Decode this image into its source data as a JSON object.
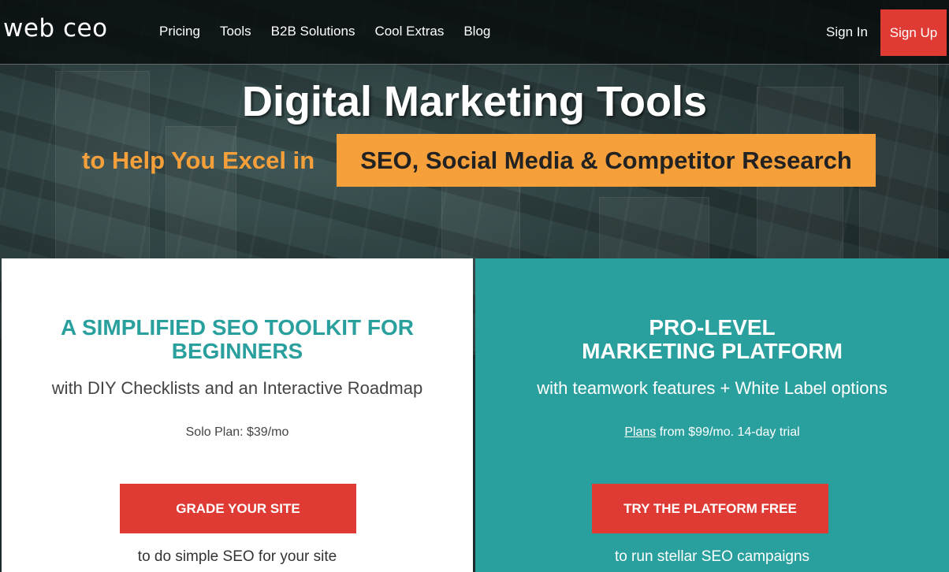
{
  "header": {
    "logo_text": "web ceo",
    "nav": [
      {
        "label": "Pricing"
      },
      {
        "label": "Tools"
      },
      {
        "label": "B2B Solutions"
      },
      {
        "label": "Cool Extras"
      },
      {
        "label": "Blog"
      }
    ],
    "sign_in": "Sign In",
    "sign_up": "Sign Up"
  },
  "hero": {
    "title": "Digital Marketing Tools",
    "subtitle": "to Help You Excel in",
    "highlight": "SEO, Social Media & Competitor Research"
  },
  "cards": {
    "left": {
      "title_line1": "A SIMPLIFIED SEO TOOLKIT FOR",
      "title_line2": "BEGINNERS",
      "subtitle": "with DIY Checklists and an Interactive Roadmap",
      "plan": "Solo Plan: $39/mo",
      "button": "GRADE YOUR SITE",
      "note": "to do simple SEO for your site"
    },
    "right": {
      "title_line1": "PRO-LEVEL",
      "title_line2": "MARKETING PLATFORM",
      "subtitle": "with teamwork features + White Label options",
      "plan_link": "Plans",
      "plan_rest": " from $99/mo. 14-day trial",
      "button": "TRY THE PLATFORM FREE",
      "note": "to run stellar SEO campaigns"
    }
  },
  "colors": {
    "accent_red": "#e03a35",
    "accent_orange": "#f5a03a",
    "teal": "#2aa09e"
  }
}
